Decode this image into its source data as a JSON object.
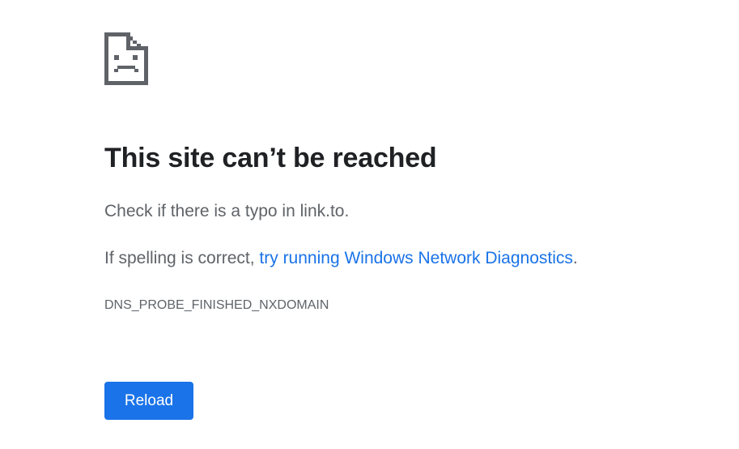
{
  "error_page": {
    "icon": "sad-page-icon",
    "title": "This site can’t be reached",
    "message_check": "Check if there is a typo in link.to.",
    "message_spelling_prefix": "If spelling is correct, ",
    "diagnostics_link": "try running Windows Network Diagnostics",
    "message_spelling_suffix": ".",
    "error_code": "DNS_PROBE_FINISHED_NXDOMAIN",
    "reload_label": "Reload"
  },
  "colors": {
    "title": "#202124",
    "body_text": "#5f6368",
    "link": "#1a73e8",
    "button_bg": "#1a73e8",
    "button_text": "#ffffff",
    "icon": "#5f6368"
  }
}
